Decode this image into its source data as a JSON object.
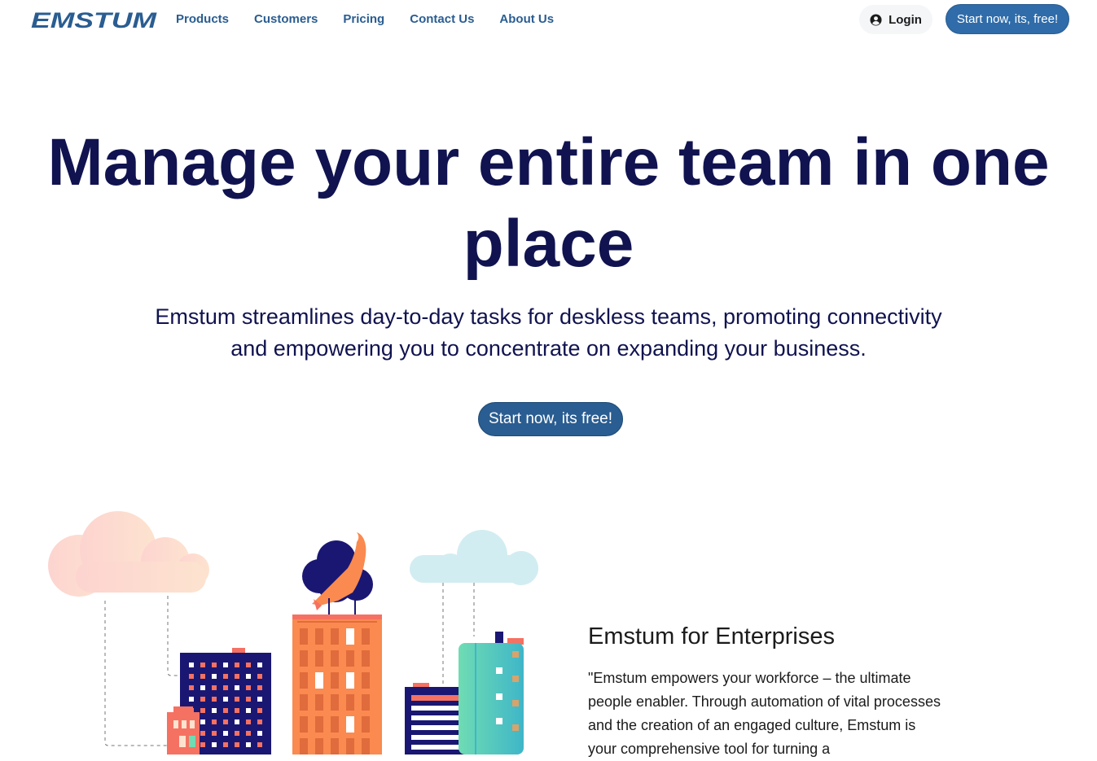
{
  "brand": {
    "name": "EMSTUM",
    "color": "#2a5d91"
  },
  "nav": {
    "links": [
      "Products",
      "Customers",
      "Pricing",
      "Contact Us",
      "About Us"
    ],
    "login_label": "Login",
    "login_icon": "user-circle-icon",
    "start_label": "Start now, its, free!"
  },
  "hero": {
    "title": "Manage your entire team in one place",
    "subtitle": "Emstum streamlines day-to-day tasks for deskless teams, promoting connectivity and empowering you to concentrate on expanding your business.",
    "cta_label": "Start now, its free!"
  },
  "enterprise": {
    "title": "Emstum for Enterprises",
    "body": "\"Emstum empowers your workforce – the ultimate people enabler. Through automation of vital processes and the creation of an engaged culture, Emstum is your comprehensive tool for turning a"
  },
  "colors": {
    "navy": "#10134f",
    "accent": "#2a5d91",
    "building_navy": "#1a1773",
    "building_orange": "#fa8a4f",
    "building_coral": "#f57162",
    "building_teal": "#5fd4b8"
  }
}
